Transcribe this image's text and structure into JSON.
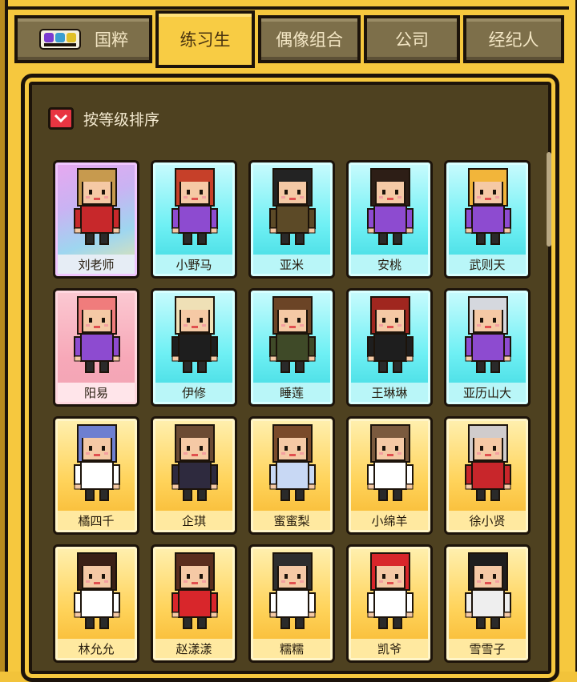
{
  "tabs": [
    {
      "label": "国粹",
      "icon": "mask-icon"
    },
    {
      "label": "练习生",
      "active": true
    },
    {
      "label": "偶像组合"
    },
    {
      "label": "公司"
    },
    {
      "label": "经纪人"
    }
  ],
  "sort": {
    "label": "按等级排序",
    "icon": "chevron-down-icon"
  },
  "trainees": [
    {
      "name": "刘老师",
      "rarity": "legend",
      "hair": "#c79a4e",
      "outfit": "#c7282b",
      "skin": "#f5c9a5"
    },
    {
      "name": "小野马",
      "rarity": "cyan",
      "hair": "#c64029",
      "outfit": "#8d4bd0",
      "skin": "#f5c9a5"
    },
    {
      "name": "亚米",
      "rarity": "cyan",
      "hair": "#232323",
      "outfit": "#5c4a27",
      "skin": "#f5c9a5"
    },
    {
      "name": "安桃",
      "rarity": "cyan",
      "hair": "#2d1e16",
      "outfit": "#8d4bd0",
      "skin": "#f5c9a5"
    },
    {
      "name": "武则天",
      "rarity": "cyan",
      "hair": "#f2b53a",
      "outfit": "#8d4bd0",
      "skin": "#f5c9a5"
    },
    {
      "name": "阳易",
      "rarity": "pink",
      "hair": "#f07c7c",
      "outfit": "#8d4bd0",
      "skin": "#f5c9a5"
    },
    {
      "name": "伊修",
      "rarity": "cyan",
      "hair": "#efe0b6",
      "outfit": "#1e1e1e",
      "skin": "#f5c9a5"
    },
    {
      "name": "睡莲",
      "rarity": "cyan",
      "hair": "#6b4426",
      "outfit": "#3f4a28",
      "skin": "#f5c9a5"
    },
    {
      "name": "王琳琳",
      "rarity": "cyan",
      "hair": "#a0261f",
      "outfit": "#1e1e1e",
      "skin": "#f5c9a5"
    },
    {
      "name": "亚历山大",
      "rarity": "cyan",
      "hair": "#d5d8de",
      "outfit": "#8d4bd0",
      "skin": "#f5c9a5"
    },
    {
      "name": "橘四千",
      "rarity": "gold",
      "hair": "#6e7fd0",
      "outfit": "#ffffff",
      "skin": "#f5c9a5"
    },
    {
      "name": "企琪",
      "rarity": "gold",
      "hair": "#6b4b33",
      "outfit": "#2e2a3e",
      "skin": "#f5c9a5"
    },
    {
      "name": "蜜蜜梨",
      "rarity": "gold",
      "hair": "#7a4a2a",
      "outfit": "#c8d8f4",
      "skin": "#f5c9a5"
    },
    {
      "name": "小绵羊",
      "rarity": "gold",
      "hair": "#7b5a3e",
      "outfit": "#ffffff",
      "skin": "#f5c9a5"
    },
    {
      "name": "徐小贤",
      "rarity": "gold",
      "hair": "#d0cccc",
      "outfit": "#c8262b",
      "skin": "#f5c9a5"
    },
    {
      "name": "林允允",
      "rarity": "gold",
      "hair": "#3b2016",
      "outfit": "#ffffff",
      "skin": "#f5c9a5"
    },
    {
      "name": "赵漾漾",
      "rarity": "gold",
      "hair": "#5a2e1e",
      "outfit": "#d8262b",
      "skin": "#f5c9a5"
    },
    {
      "name": "糯糯",
      "rarity": "gold",
      "hair": "#2e2e2e",
      "outfit": "#ffffff",
      "skin": "#f5c9a5"
    },
    {
      "name": "凯爷",
      "rarity": "gold",
      "hair": "#d8262b",
      "outfit": "#ffffff",
      "skin": "#f5c9a5"
    },
    {
      "name": "雪雪子",
      "rarity": "gold",
      "hair": "#1e1e1e",
      "outfit": "#eeeeee",
      "skin": "#f5c9a5"
    }
  ]
}
